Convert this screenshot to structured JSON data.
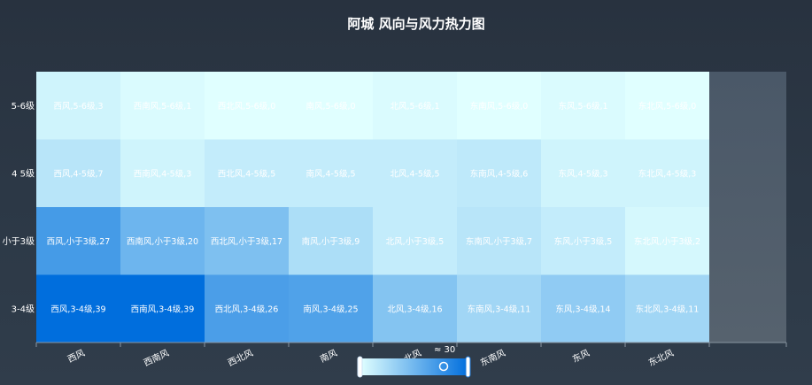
{
  "chart_data": {
    "type": "heatmap",
    "title": "阿城 风向与风力热力图",
    "x_categories": [
      "西风",
      "西南风",
      "西北风",
      "南风",
      "北风",
      "东南风",
      "东风",
      "东北风"
    ],
    "y_categories": [
      "3-4级",
      "小于3级",
      "4-5级",
      "5-6级"
    ],
    "y_tick_labels": [
      "3-4级",
      "小于3级",
      "4 5级",
      "5-6级"
    ],
    "cells": [
      {
        "x": "西风",
        "y": "5-6级",
        "value": 3,
        "label": "西风,5-6级,3"
      },
      {
        "x": "西南风",
        "y": "5-6级",
        "value": 1,
        "label": "西南风,5-6级,1"
      },
      {
        "x": "西北风",
        "y": "5-6级",
        "value": 0,
        "label": "西北风,5-6级,0"
      },
      {
        "x": "南风",
        "y": "5-6级",
        "value": 0,
        "label": "南风,5-6级,0"
      },
      {
        "x": "北风",
        "y": "5-6级",
        "value": 1,
        "label": "北风,5-6级,1"
      },
      {
        "x": "东南风",
        "y": "5-6级",
        "value": 0,
        "label": "东南风,5-6级,0"
      },
      {
        "x": "东风",
        "y": "5-6级",
        "value": 1,
        "label": "东风,5-6级,1"
      },
      {
        "x": "东北风",
        "y": "5-6级",
        "value": 0,
        "label": "东北风,5-6级,0"
      },
      {
        "x": "西风",
        "y": "4-5级",
        "value": 7,
        "label": "西风,4-5级,7"
      },
      {
        "x": "西南风",
        "y": "4-5级",
        "value": 3,
        "label": "西南风,4-5级,3"
      },
      {
        "x": "西北风",
        "y": "4-5级",
        "value": 5,
        "label": "西北风,4-5级,5"
      },
      {
        "x": "南风",
        "y": "4-5级",
        "value": 5,
        "label": "南风,4-5级,5"
      },
      {
        "x": "北风",
        "y": "4-5级",
        "value": 5,
        "label": "北风,4-5级,5"
      },
      {
        "x": "东南风",
        "y": "4-5级",
        "value": 6,
        "label": "东南风,4-5级,6"
      },
      {
        "x": "东风",
        "y": "4-5级",
        "value": 3,
        "label": "东风,4-5级,3"
      },
      {
        "x": "东北风",
        "y": "4-5级",
        "value": 3,
        "label": "东北风,4-5级,3"
      },
      {
        "x": "西风",
        "y": "小于3级",
        "value": 27,
        "label": "西风,小于3级,27"
      },
      {
        "x": "西南风",
        "y": "小于3级",
        "value": 20,
        "label": "西南风,小于3级,20"
      },
      {
        "x": "西北风",
        "y": "小于3级",
        "value": 17,
        "label": "西北风,小于3级,17"
      },
      {
        "x": "南风",
        "y": "小于3级",
        "value": 9,
        "label": "南风,小于3级,9"
      },
      {
        "x": "北风",
        "y": "小于3级",
        "value": 5,
        "label": "北风,小于3级,5"
      },
      {
        "x": "东南风",
        "y": "小于3级",
        "value": 7,
        "label": "东南风,小于3级,7"
      },
      {
        "x": "东风",
        "y": "小于3级",
        "value": 5,
        "label": "东风,小于3级,5"
      },
      {
        "x": "东北风",
        "y": "小于3级",
        "value": 2,
        "label": "东北风,小于3级,2"
      },
      {
        "x": "西风",
        "y": "3-4级",
        "value": 39,
        "label": "西风,3-4级,39"
      },
      {
        "x": "西南风",
        "y": "3-4级",
        "value": 39,
        "label": "西南风,3-4级,39"
      },
      {
        "x": "西北风",
        "y": "3-4级",
        "value": 26,
        "label": "西北风,3-4级,26"
      },
      {
        "x": "南风",
        "y": "3-4级",
        "value": 25,
        "label": "南风,3-4级,25"
      },
      {
        "x": "北风",
        "y": "3-4级",
        "value": 16,
        "label": "北风,3-4级,16"
      },
      {
        "x": "东南风",
        "y": "3-4级",
        "value": 11,
        "label": "东南风,3-4级,11"
      },
      {
        "x": "东风",
        "y": "3-4级",
        "value": 14,
        "label": "东风,3-4级,14"
      },
      {
        "x": "东北风",
        "y": "3-4级",
        "value": 11,
        "label": "东北风,3-4级,11"
      }
    ],
    "visual_map": {
      "min": 0,
      "max": 39,
      "indicator_label": "≈ 30",
      "color_low": "#e0ffff",
      "color_high": "#006edd"
    },
    "colors": {
      "empty_column": "#4a5968",
      "axis_line": "#8a96a3"
    }
  }
}
